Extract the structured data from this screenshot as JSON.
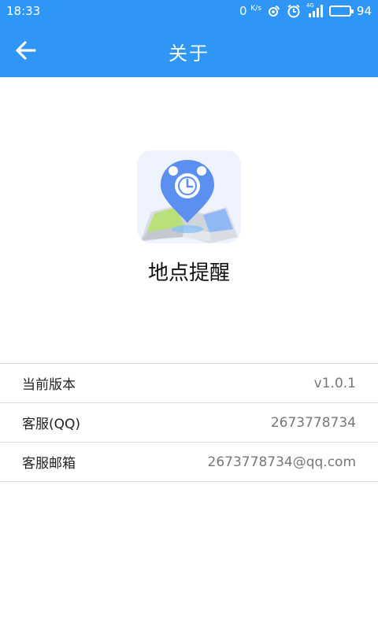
{
  "status_bar": {
    "time": "18:33",
    "net_speed": "0",
    "net_unit": "K/s",
    "signal": "4G",
    "battery": "94",
    "battery_level": 0.94
  },
  "header": {
    "title": "关于",
    "back_icon": "arrow-left-icon",
    "background": "#2f96f5"
  },
  "app": {
    "name": "地点提醒",
    "icon": "location-alarm-map-icon"
  },
  "info": {
    "rows": [
      {
        "label": "当前版本",
        "value": "v1.0.1"
      },
      {
        "label": "客服(QQ)",
        "value": "2673778734"
      },
      {
        "label": "客服邮箱",
        "value": "2673778734@qq.com"
      }
    ]
  }
}
